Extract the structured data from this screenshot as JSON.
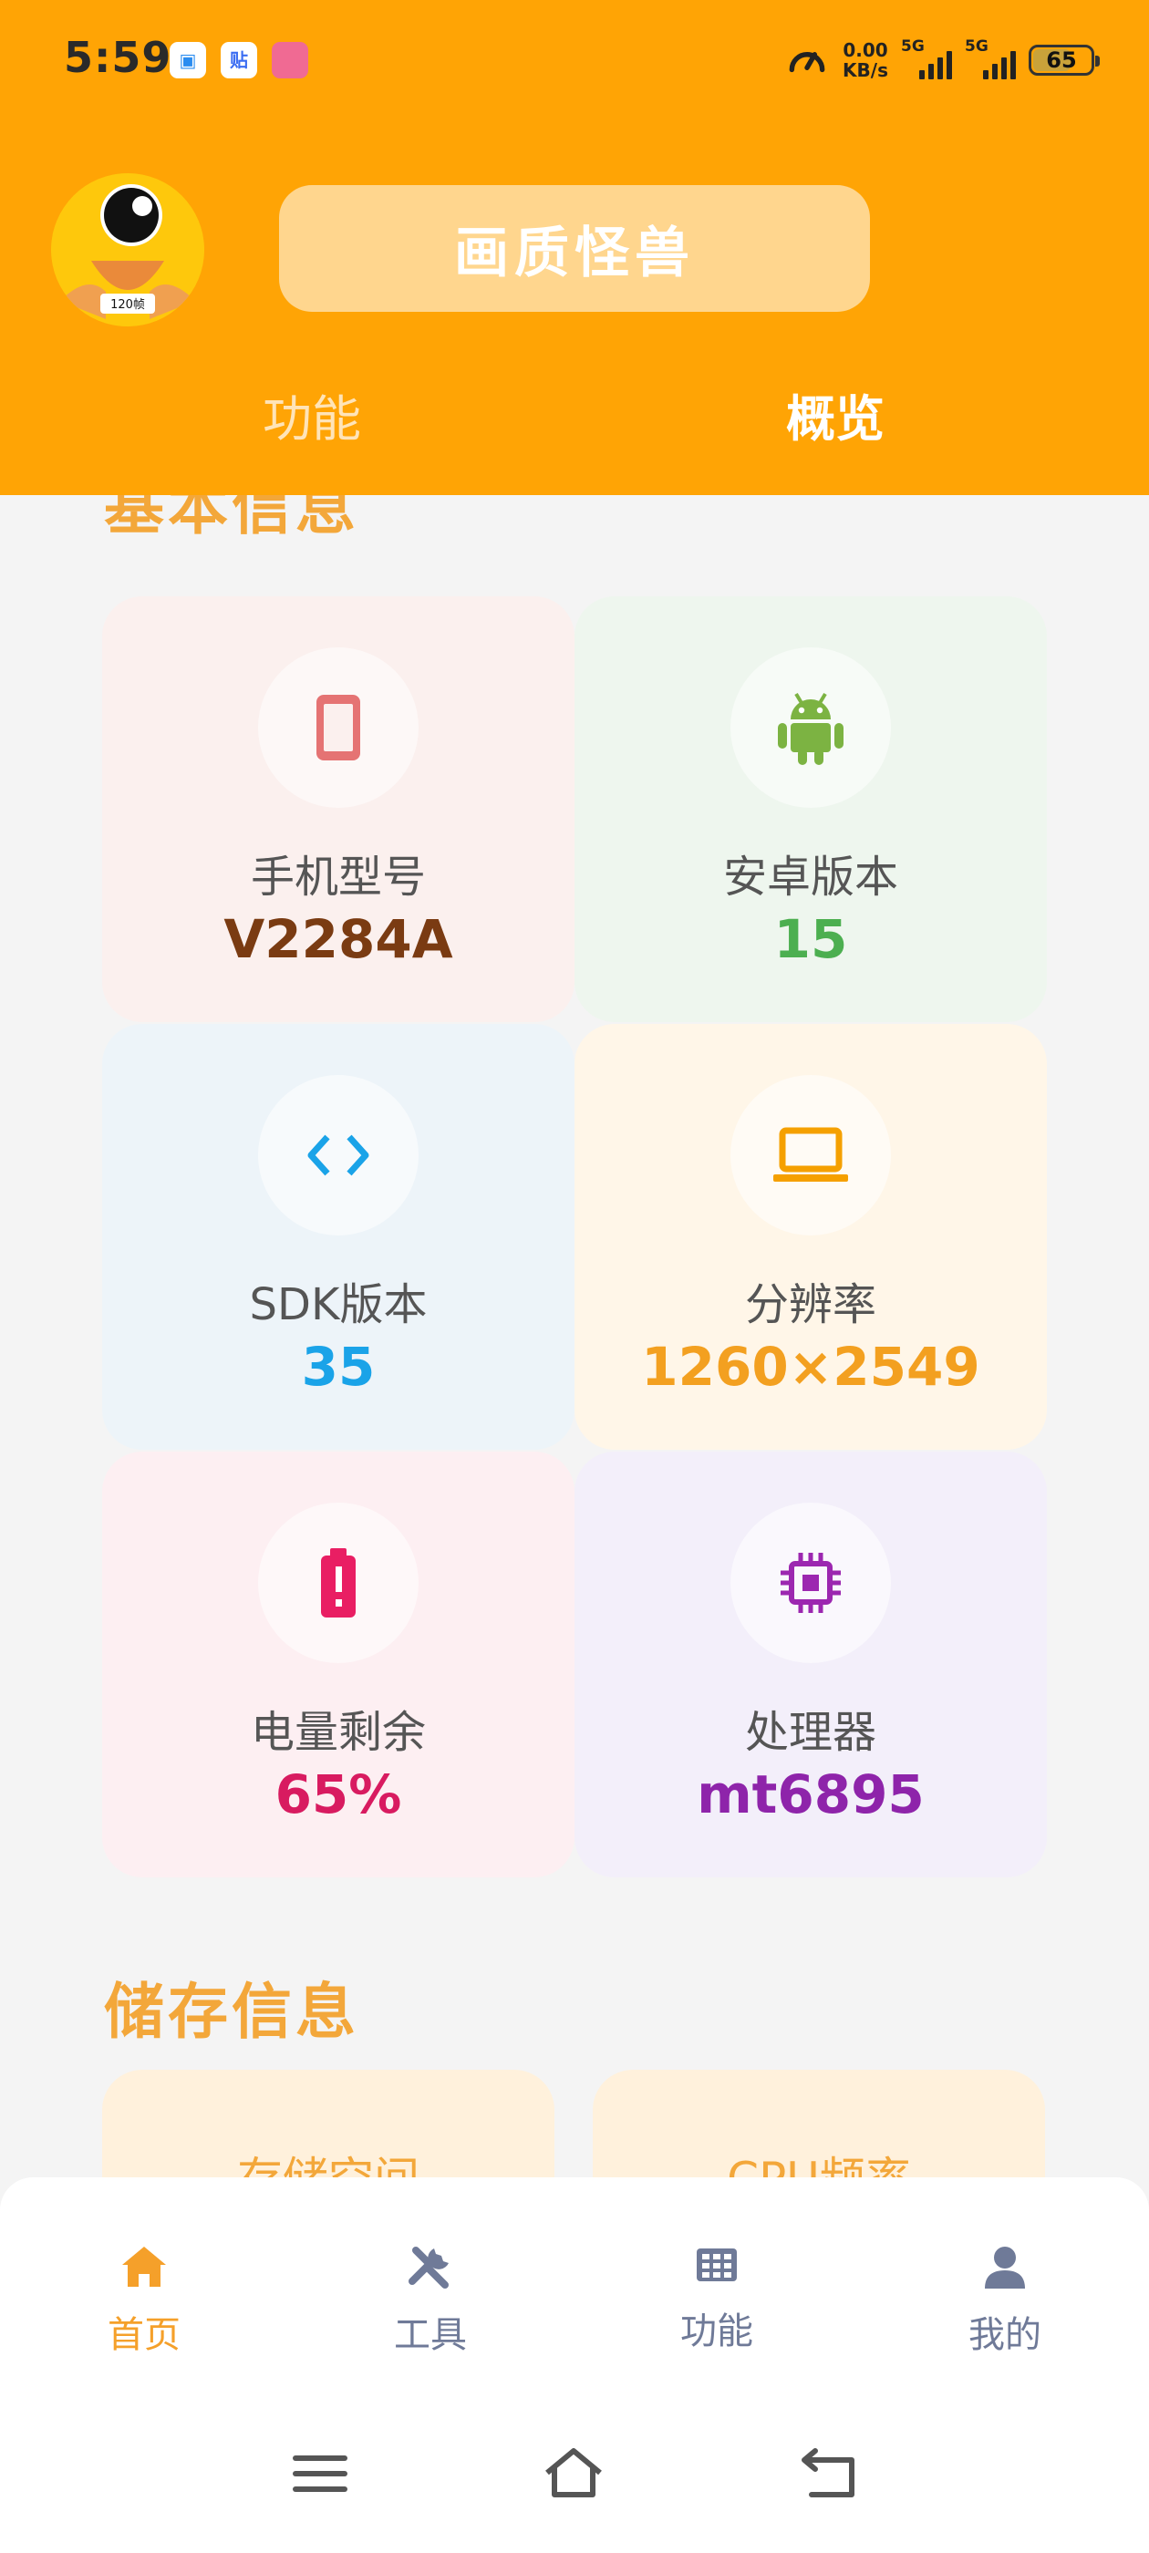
{
  "status_bar": {
    "time": "5:59",
    "app_icons": [
      {
        "name": "blue-app-icon",
        "glyph": "▣",
        "color": "#2a8cf0"
      },
      {
        "name": "tieba-app-icon",
        "glyph": "贴",
        "color": "#3b6df2"
      },
      {
        "name": "bilibili-app-icon",
        "glyph": "ʟʟ",
        "color": "#f06a93"
      }
    ],
    "speed_value": "0.00",
    "speed_unit": "KB/s",
    "network_1": "5G",
    "network_2": "5G",
    "battery": "65"
  },
  "header": {
    "app_logo_badge": "120帧",
    "title": "画质怪兽",
    "tabs": [
      {
        "label": "功能",
        "active": false
      },
      {
        "label": "概览",
        "active": true
      }
    ]
  },
  "basic_info": {
    "title": "基本信息",
    "cards": [
      {
        "icon": "phone-icon",
        "label": "手机型号",
        "value": "V2284A",
        "value_color": "#7a3b12",
        "bg": "#fbf0ee",
        "icon_color": "#e57373"
      },
      {
        "icon": "android-icon",
        "label": "安卓版本",
        "value": "15",
        "value_color": "#4caf50",
        "bg": "#eef6ee",
        "icon_color": "#7cb342"
      },
      {
        "icon": "code-icon",
        "label": "SDK版本",
        "value": "35",
        "value_color": "#1aa3e8",
        "bg": "#edf4f9",
        "icon_color": "#1aa3e8"
      },
      {
        "icon": "laptop-icon",
        "label": "分辨率",
        "value": "1260×2549",
        "value_color": "#f3a020",
        "bg": "#fff6e8",
        "icon_color": "#f5a000"
      },
      {
        "icon": "battery-alert-icon",
        "label": "电量剩余",
        "value": "65%",
        "value_color": "#d81b60",
        "bg": "#fdeff2",
        "icon_color": "#e91e63"
      },
      {
        "icon": "chip-icon",
        "label": "处理器",
        "value": "mt6895",
        "value_color": "#8e24aa",
        "bg": "#f3effa",
        "icon_color": "#9c27b0"
      }
    ]
  },
  "storage_info": {
    "title": "储存信息",
    "cards": [
      {
        "label": "存储空间"
      },
      {
        "label": "CPU频率"
      }
    ]
  },
  "bottom_nav": {
    "items": [
      {
        "icon": "home-icon",
        "label": "首页",
        "active": true
      },
      {
        "icon": "tools-icon",
        "label": "工具",
        "active": false
      },
      {
        "icon": "grid-icon",
        "label": "功能",
        "active": false
      },
      {
        "icon": "user-icon",
        "label": "我的",
        "active": false
      }
    ],
    "active_color": "#f5a02a",
    "inactive_color": "#6f7a98"
  },
  "system_nav": {
    "buttons": [
      "menu-icon",
      "home-outline-icon",
      "back-icon"
    ]
  }
}
